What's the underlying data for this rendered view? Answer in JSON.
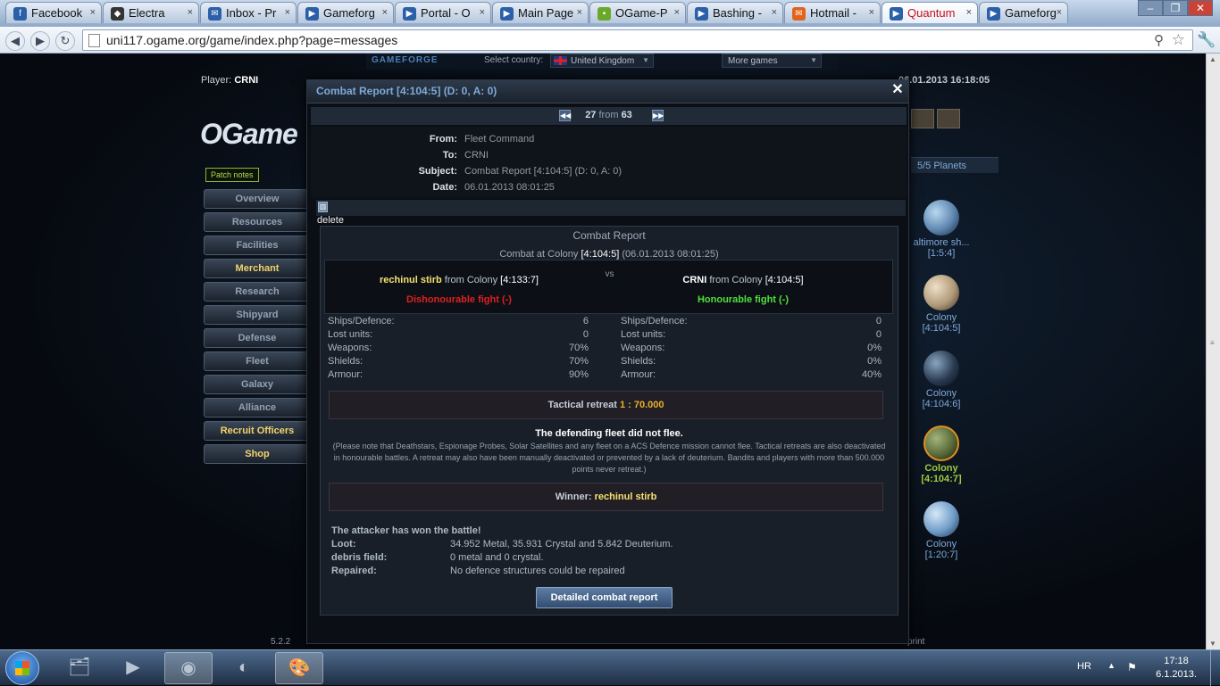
{
  "browser": {
    "tabs": [
      {
        "label": "Facebook",
        "icon": "facebook-icon",
        "active": false
      },
      {
        "label": "Electra",
        "icon": "game-icon",
        "active": false
      },
      {
        "label": "Inbox - Pr",
        "icon": "mail-icon",
        "active": false
      },
      {
        "label": "Gameforg",
        "icon": "gameforge-icon",
        "active": false
      },
      {
        "label": "Portal - O",
        "icon": "gameforge-icon",
        "active": false
      },
      {
        "label": "Main Page",
        "icon": "gameforge-icon",
        "active": false
      },
      {
        "label": "OGame-P",
        "icon": "chat-icon",
        "active": false
      },
      {
        "label": "Bashing -",
        "icon": "gameforge-icon",
        "active": false
      },
      {
        "label": "Hotmail -",
        "icon": "hotmail-icon",
        "active": false
      },
      {
        "label": "Quantum",
        "icon": "gameforge-icon",
        "active": true
      },
      {
        "label": "Gameforg",
        "icon": "gameforge-icon",
        "active": false
      }
    ],
    "url": "uni117.ogame.org/game/index.php?page=messages"
  },
  "gameforge": {
    "logo": "GAMEFORGE",
    "select_country_label": "Select country:",
    "country": "United Kingdom",
    "more_games": "More games"
  },
  "header": {
    "player_label": "Player:",
    "player_name": "CRNI",
    "server_time": "06.01.2013 16:18:05"
  },
  "sidebar": {
    "logo": "OGame",
    "patch_notes": "Patch notes",
    "items": [
      {
        "label": "Overview",
        "highlight": false
      },
      {
        "label": "Resources",
        "highlight": false
      },
      {
        "label": "Facilities",
        "highlight": false
      },
      {
        "label": "Merchant",
        "highlight": true
      },
      {
        "label": "Research",
        "highlight": false
      },
      {
        "label": "Shipyard",
        "highlight": false
      },
      {
        "label": "Defense",
        "highlight": false
      },
      {
        "label": "Fleet",
        "highlight": false
      },
      {
        "label": "Galaxy",
        "highlight": false
      },
      {
        "label": "Alliance",
        "highlight": false
      },
      {
        "label": "Recruit Officers",
        "highlight": true
      },
      {
        "label": "Shop",
        "highlight": true
      }
    ],
    "version": "5.2.2"
  },
  "footer": {
    "print": "print"
  },
  "planets": {
    "count": "5/5 Planets",
    "list": [
      {
        "name": "altimore sh...",
        "coords": "[1:5:4]",
        "current": false,
        "color": "#5d86b0"
      },
      {
        "name": "Colony",
        "coords": "[4:104:5]",
        "current": false,
        "color": "#b09a7a"
      },
      {
        "name": "Colony",
        "coords": "[4:104:6]",
        "current": false,
        "color": "#2a3c52"
      },
      {
        "name": "Colony",
        "coords": "[4:104:7]",
        "current": true,
        "color": "#5a6b3a"
      },
      {
        "name": "Colony",
        "coords": "[1:20:7]",
        "current": false,
        "color": "#6f9cc8"
      }
    ]
  },
  "message": {
    "title": "Combat Report [4:104:5] (D: 0, A: 0)",
    "position": "27",
    "from_word": "from",
    "total": "63",
    "from_label": "From:",
    "from_value": "Fleet Command",
    "to_label": "To:",
    "to_value": "CRNI",
    "subject_label": "Subject:",
    "subject_value": "Combat Report [4:104:5] (D: 0, A: 0)",
    "date_label": "Date:",
    "date_value": "06.01.2013 08:01:25",
    "delete_label": "delete"
  },
  "report": {
    "title": "Combat Report",
    "combat_at_prefix": "Combat at Colony",
    "combat_coords": "[4:104:5]",
    "combat_time": "(06.01.2013 08:01:25)",
    "vs": "vs",
    "attacker": {
      "name": "rechinul stirb",
      "from_text": "from Colony",
      "coords": "[4:133:7]",
      "fight": "Dishonourable fight (-)",
      "stats": [
        {
          "label": "Ships/Defence:",
          "value": "6"
        },
        {
          "label": "Lost units:",
          "value": "0"
        },
        {
          "label": "Weapons:",
          "value": "70%"
        },
        {
          "label": "Shields:",
          "value": "70%"
        },
        {
          "label": "Armour:",
          "value": "90%"
        }
      ]
    },
    "defender": {
      "name": "CRNI",
      "from_text": "from Colony",
      "coords": "[4:104:5]",
      "fight": "Honourable fight (-)",
      "stats": [
        {
          "label": "Ships/Defence:",
          "value": "0"
        },
        {
          "label": "Lost units:",
          "value": "0"
        },
        {
          "label": "Weapons:",
          "value": "0%"
        },
        {
          "label": "Shields:",
          "value": "0%"
        },
        {
          "label": "Armour:",
          "value": "40%"
        }
      ]
    },
    "tactical_label": "Tactical retreat",
    "tactical_value": "1 : 70.000",
    "not_flee": "The defending fleet did not flee.",
    "note": "(Please note that Deathstars, Espionage Probes, Solar Satellites and any fleet on a ACS Defence mission cannot flee. Tactical retreats are also deactivated in honourable battles. A retreat may also have been manually deactivated or prevented by a lack of deuterium. Bandits and players with more than 500.000 points never retreat.)",
    "winner_label": "Winner:",
    "winner_value": "rechinul stirb",
    "outcome": "The attacker has won the battle!",
    "loot_label": "Loot:",
    "loot_value": "34.952 Metal, 35.931 Crystal and 5.842 Deuterium.",
    "debris_label": "debris field:",
    "debris_value": "0 metal and 0 crystal.",
    "repaired_label": "Repaired:",
    "repaired_value": "No defence structures could be repaired",
    "detailed_button": "Detailed combat report"
  },
  "taskbar": {
    "lang": "HR",
    "time": "17:18",
    "date": "6.1.2013."
  }
}
